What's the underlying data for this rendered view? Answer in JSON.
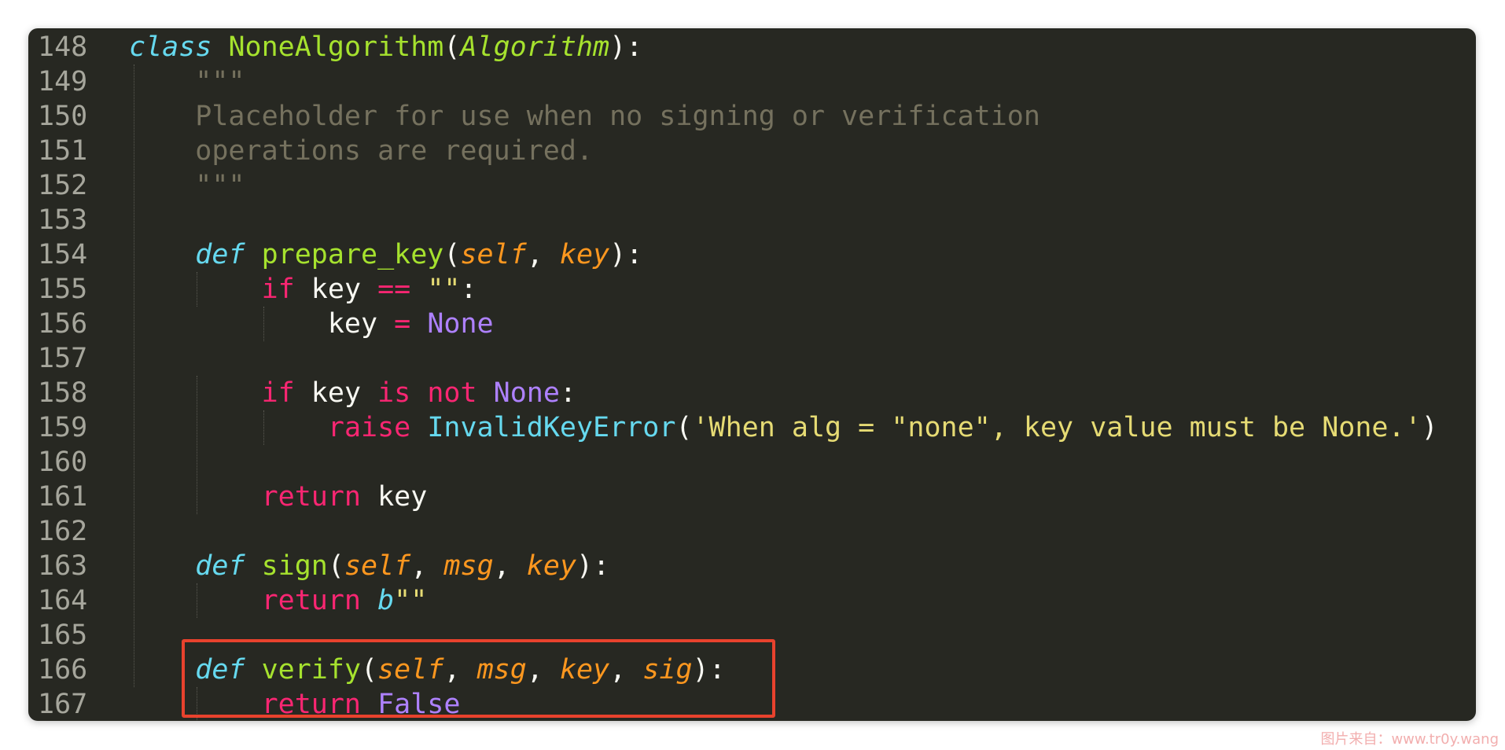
{
  "editor": {
    "theme_colors": {
      "background": "#272822",
      "keyword": "#f92672",
      "def_keyword": "#66d9ef",
      "function_name": "#a6e22e",
      "parameter": "#fd971f",
      "string": "#e6db74",
      "constant": "#ae81ff",
      "comment": "#75715e",
      "highlight_border": "#e8422d"
    },
    "lines": [
      {
        "num": "148",
        "tokens": [
          {
            "t": "class",
            "c": "tok-kw-it"
          },
          {
            "t": " ",
            "c": "tok-plain"
          },
          {
            "t": "NoneAlgorithm",
            "c": "tok-name"
          },
          {
            "t": "(",
            "c": "tok-plain"
          },
          {
            "t": "Algorithm",
            "c": "tok-base"
          },
          {
            "t": "):",
            "c": "tok-plain"
          }
        ]
      },
      {
        "num": "149",
        "tokens": [
          {
            "t": "    \"\"\"",
            "c": "tok-comment"
          }
        ]
      },
      {
        "num": "150",
        "tokens": [
          {
            "t": "    Placeholder for use when no signing or verification",
            "c": "tok-comment"
          }
        ]
      },
      {
        "num": "151",
        "tokens": [
          {
            "t": "    operations are required.",
            "c": "tok-comment"
          }
        ]
      },
      {
        "num": "152",
        "tokens": [
          {
            "t": "    \"\"\"",
            "c": "tok-comment"
          }
        ]
      },
      {
        "num": "153",
        "tokens": []
      },
      {
        "num": "154",
        "tokens": [
          {
            "t": "    ",
            "c": "tok-plain"
          },
          {
            "t": "def",
            "c": "tok-kw-it"
          },
          {
            "t": " ",
            "c": "tok-plain"
          },
          {
            "t": "prepare_key",
            "c": "tok-name"
          },
          {
            "t": "(",
            "c": "tok-plain"
          },
          {
            "t": "self",
            "c": "tok-param"
          },
          {
            "t": ", ",
            "c": "tok-plain"
          },
          {
            "t": "key",
            "c": "tok-param"
          },
          {
            "t": "):",
            "c": "tok-plain"
          }
        ]
      },
      {
        "num": "155",
        "tokens": [
          {
            "t": "        ",
            "c": "tok-plain"
          },
          {
            "t": "if",
            "c": "tok-kw"
          },
          {
            "t": " key ",
            "c": "tok-plain"
          },
          {
            "t": "==",
            "c": "tok-kw"
          },
          {
            "t": " ",
            "c": "tok-plain"
          },
          {
            "t": "\"\"",
            "c": "tok-str"
          },
          {
            "t": ":",
            "c": "tok-plain"
          }
        ]
      },
      {
        "num": "156",
        "tokens": [
          {
            "t": "            key ",
            "c": "tok-plain"
          },
          {
            "t": "=",
            "c": "tok-kw"
          },
          {
            "t": " ",
            "c": "tok-plain"
          },
          {
            "t": "None",
            "c": "tok-const"
          }
        ]
      },
      {
        "num": "157",
        "tokens": []
      },
      {
        "num": "158",
        "tokens": [
          {
            "t": "        ",
            "c": "tok-plain"
          },
          {
            "t": "if",
            "c": "tok-kw"
          },
          {
            "t": " key ",
            "c": "tok-plain"
          },
          {
            "t": "is",
            "c": "tok-kw"
          },
          {
            "t": " ",
            "c": "tok-plain"
          },
          {
            "t": "not",
            "c": "tok-kw"
          },
          {
            "t": " ",
            "c": "tok-plain"
          },
          {
            "t": "None",
            "c": "tok-const"
          },
          {
            "t": ":",
            "c": "tok-plain"
          }
        ]
      },
      {
        "num": "159",
        "tokens": [
          {
            "t": "            ",
            "c": "tok-plain"
          },
          {
            "t": "raise",
            "c": "tok-kw"
          },
          {
            "t": " ",
            "c": "tok-plain"
          },
          {
            "t": "InvalidKeyError",
            "c": "tok-builtin"
          },
          {
            "t": "(",
            "c": "tok-plain"
          },
          {
            "t": "'When alg = \"none\", key value must be None.'",
            "c": "tok-str"
          },
          {
            "t": ")",
            "c": "tok-plain"
          }
        ]
      },
      {
        "num": "160",
        "tokens": []
      },
      {
        "num": "161",
        "tokens": [
          {
            "t": "        ",
            "c": "tok-plain"
          },
          {
            "t": "return",
            "c": "tok-kw"
          },
          {
            "t": " key",
            "c": "tok-plain"
          }
        ]
      },
      {
        "num": "162",
        "tokens": []
      },
      {
        "num": "163",
        "tokens": [
          {
            "t": "    ",
            "c": "tok-plain"
          },
          {
            "t": "def",
            "c": "tok-kw-it"
          },
          {
            "t": " ",
            "c": "tok-plain"
          },
          {
            "t": "sign",
            "c": "tok-name"
          },
          {
            "t": "(",
            "c": "tok-plain"
          },
          {
            "t": "self",
            "c": "tok-param"
          },
          {
            "t": ", ",
            "c": "tok-plain"
          },
          {
            "t": "msg",
            "c": "tok-param"
          },
          {
            "t": ", ",
            "c": "tok-plain"
          },
          {
            "t": "key",
            "c": "tok-param"
          },
          {
            "t": "):",
            "c": "tok-plain"
          }
        ]
      },
      {
        "num": "164",
        "tokens": [
          {
            "t": "        ",
            "c": "tok-plain"
          },
          {
            "t": "return",
            "c": "tok-kw"
          },
          {
            "t": " ",
            "c": "tok-plain"
          },
          {
            "t": "b",
            "c": "tok-prefix"
          },
          {
            "t": "\"\"",
            "c": "tok-str"
          }
        ]
      },
      {
        "num": "165",
        "tokens": []
      },
      {
        "num": "166",
        "tokens": [
          {
            "t": "    ",
            "c": "tok-plain"
          },
          {
            "t": "def",
            "c": "tok-kw-it"
          },
          {
            "t": " ",
            "c": "tok-plain"
          },
          {
            "t": "verify",
            "c": "tok-name"
          },
          {
            "t": "(",
            "c": "tok-plain"
          },
          {
            "t": "self",
            "c": "tok-param"
          },
          {
            "t": ", ",
            "c": "tok-plain"
          },
          {
            "t": "msg",
            "c": "tok-param"
          },
          {
            "t": ", ",
            "c": "tok-plain"
          },
          {
            "t": "key",
            "c": "tok-param"
          },
          {
            "t": ", ",
            "c": "tok-plain"
          },
          {
            "t": "sig",
            "c": "tok-param"
          },
          {
            "t": "):",
            "c": "tok-plain"
          }
        ]
      },
      {
        "num": "167",
        "tokens": [
          {
            "t": "        ",
            "c": "tok-plain"
          },
          {
            "t": "return",
            "c": "tok-kw"
          },
          {
            "t": " ",
            "c": "tok-plain"
          },
          {
            "t": "False",
            "c": "tok-const"
          }
        ]
      }
    ]
  },
  "watermark": {
    "text": "图片来自：www.tr0y.wang"
  }
}
